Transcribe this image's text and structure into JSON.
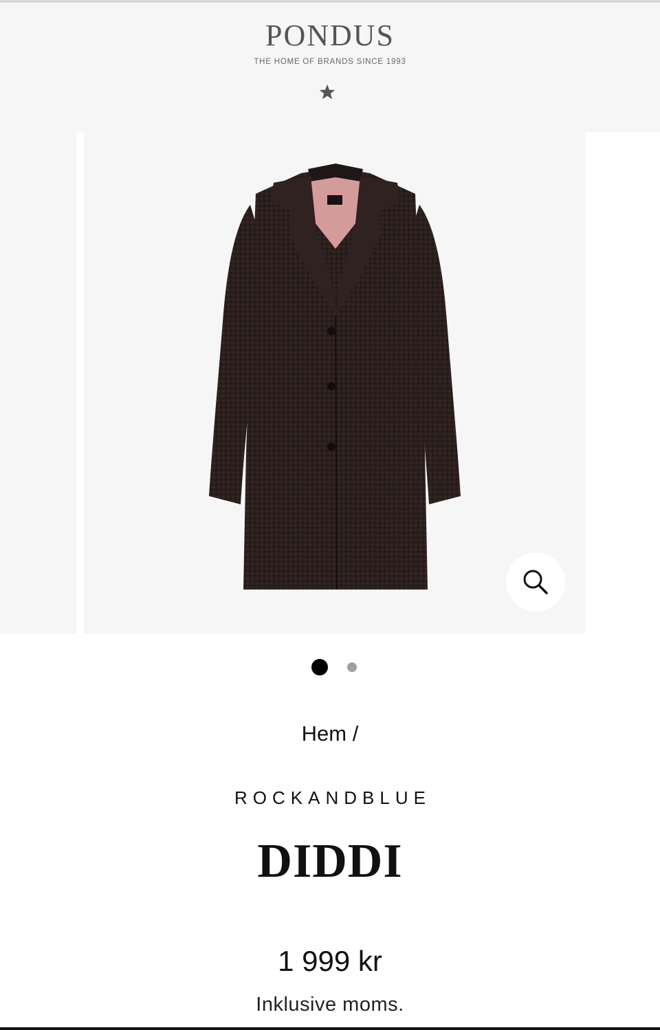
{
  "header": {
    "logo": "PONDUS",
    "tagline": "THE HOME OF BRANDS SINCE 1993",
    "star_icon": "star-icon"
  },
  "gallery": {
    "image_count": 2,
    "active_index": 0,
    "zoom_icon": "search-icon",
    "coat_color": "#2a1f1e",
    "lining_color": "#d49b9b"
  },
  "breadcrumb": {
    "home_label": "Hem",
    "separator": "/"
  },
  "product": {
    "brand": "ROCKANDBLUE",
    "name": "DIDDI",
    "price": "1 999 kr",
    "vat_note": "Inklusive moms."
  },
  "colors": {
    "header_bg": "#f6f6f6",
    "text": "#111111",
    "logo_text": "#555555",
    "dot_active": "#000000",
    "dot_inactive": "#a0a0a0"
  }
}
